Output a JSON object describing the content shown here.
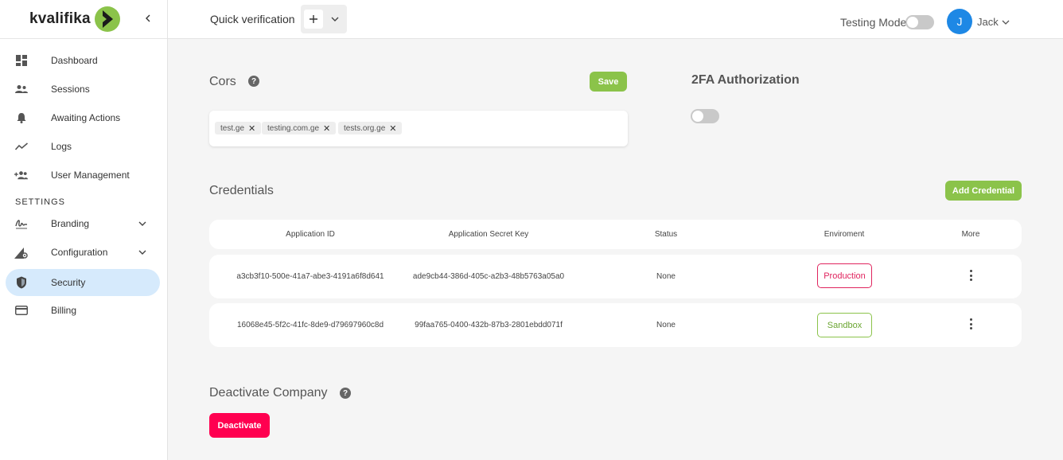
{
  "brand": {
    "name": "kvalifika",
    "accent": "#8bc34a"
  },
  "sidebar": {
    "items": [
      {
        "label": "Dashboard",
        "icon": "dashboard-icon"
      },
      {
        "label": "Sessions",
        "icon": "users-icon"
      },
      {
        "label": "Awaiting Actions",
        "icon": "bell-icon"
      },
      {
        "label": "Logs",
        "icon": "chart-line-icon"
      },
      {
        "label": "User Management",
        "icon": "user-add-icon"
      }
    ],
    "section_title": "SETTINGS",
    "settings_items": [
      {
        "label": "Branding",
        "icon": "signature-icon"
      },
      {
        "label": "Configuration",
        "icon": "config-icon"
      },
      {
        "label": "Security",
        "icon": "shield-icon"
      },
      {
        "label": "Billing",
        "icon": "card-icon"
      }
    ]
  },
  "topbar": {
    "quick_verification": "Quick verification",
    "testing_mode": "Testing Mode",
    "user_initial": "J",
    "user_name": "Jack"
  },
  "cors": {
    "title": "Cors",
    "save_label": "Save",
    "domains": [
      "test.ge",
      "testing.com.ge",
      "tests.org.ge"
    ]
  },
  "two_fa": {
    "title": "2FA Authorization"
  },
  "credentials": {
    "title": "Credentials",
    "add_label": "Add Credential",
    "columns": [
      "Application ID",
      "Application Secret Key",
      "Status",
      "Enviroment",
      "More"
    ],
    "rows": [
      {
        "app_id": "a3cb3f10-500e-41a7-abe3-4191a6f8d641",
        "secret": "ade9cb44-386d-405c-a2b3-48b5763a05a0",
        "status": "None",
        "env": "Production"
      },
      {
        "app_id": "16068e45-5f2c-41fc-8de9-d79697960c8d",
        "secret": "99faa765-0400-432b-87b3-2801ebdd071f",
        "status": "None",
        "env": "Sandbox"
      }
    ]
  },
  "deactivate": {
    "title": "Deactivate Company",
    "button_label": "Deactivate"
  }
}
